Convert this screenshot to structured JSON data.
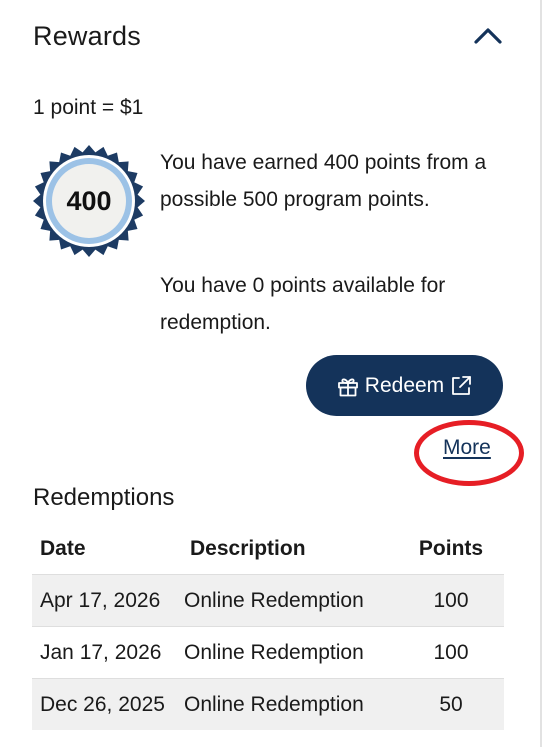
{
  "panel": {
    "title": "Rewards",
    "collapse_icon": "chevron-up-icon"
  },
  "rewards": {
    "rate_text": "1 point = $1",
    "badge_value": "400",
    "earned_text": "You have earned 400 points from a possible 500 program points.",
    "available_text": "You have 0 points available for redemption.",
    "redeem_label": "Redeem",
    "redeem_icons": [
      "gift-icon",
      "external-link-icon"
    ],
    "more_label": "More"
  },
  "redemptions": {
    "title": "Redemptions",
    "columns": [
      "Date",
      "Description",
      "Points"
    ],
    "rows": [
      {
        "date": "Apr 17, 2026",
        "description": "Online Redemption",
        "points": "100"
      },
      {
        "date": "Jan 17, 2026",
        "description": "Online Redemption",
        "points": "100"
      },
      {
        "date": "Dec 26, 2025",
        "description": "Online Redemption",
        "points": "50"
      }
    ]
  },
  "colors": {
    "primary": "#14335a",
    "highlight": "#e61e25",
    "badge_ring": "#1d3b63",
    "badge_inner": "#9cc2e6"
  }
}
